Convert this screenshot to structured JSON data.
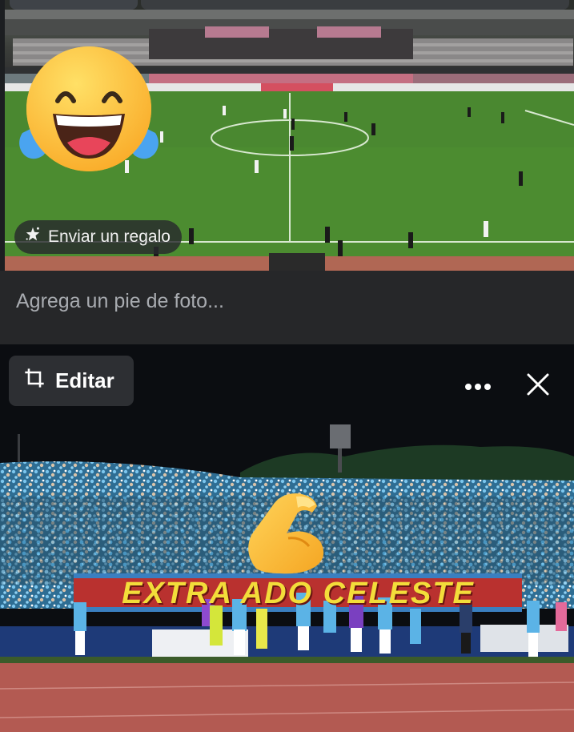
{
  "top_photo": {
    "gift_button_label": "Enviar un regalo",
    "reaction_emoji": "face-with-tears-of-joy-icon",
    "icon": "sparkle-gift-icon"
  },
  "caption": {
    "placeholder": "Agrega un pie de foto..."
  },
  "bottom_photo": {
    "edit_button_label": "Editar",
    "edit_icon": "crop-icon",
    "more_icon": "more-options-icon",
    "close_icon": "close-icon",
    "banner_text": "EXTRA ADO CELESTE",
    "reaction_emoji": "flexed-biceps-icon"
  },
  "colors": {
    "background": "#1c1e21",
    "caption_bg": "#262729",
    "button_bg": "#2d2f33",
    "pitch_green": "#4e8e32",
    "fan_blue": "#5bb3e6",
    "banner_red": "#c8322f"
  }
}
